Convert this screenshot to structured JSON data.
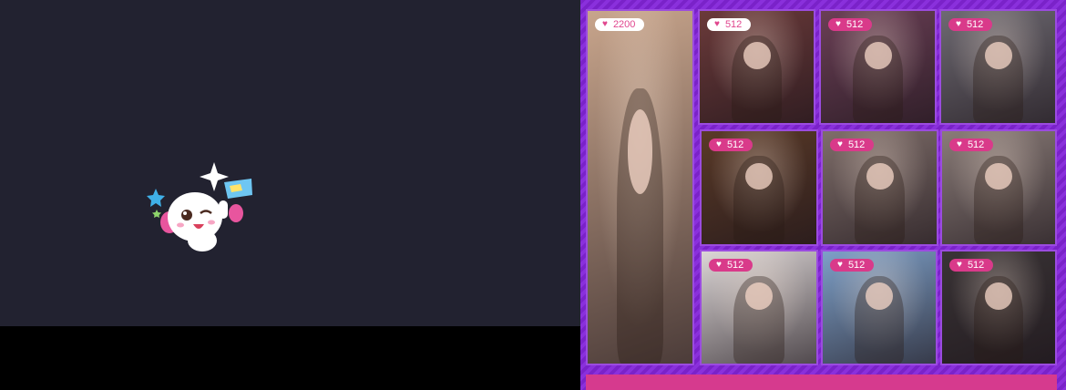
{
  "colors": {
    "left_background": "#222230",
    "right_background": "#7a22c9",
    "badge_pink": "#d93a8a",
    "badge_white": "#ffffff",
    "heart_pink": "#e0468e",
    "bottom_bar": "#d63a8e"
  },
  "mascot": {
    "icon": "winking-dog-mascot-icon"
  },
  "gallery": {
    "tiles": [
      {
        "likes": "2200",
        "badge_style": "white",
        "tone": "#c8a58c"
      },
      {
        "likes": "512",
        "badge_style": "white",
        "tone": "#6b3a3a"
      },
      {
        "likes": "512",
        "badge_style": "pink",
        "tone": "#6a3f55"
      },
      {
        "likes": "512",
        "badge_style": "pink",
        "tone": "#6e6a72"
      },
      {
        "likes": "512",
        "badge_style": "pink",
        "tone": "#5a3a28"
      },
      {
        "likes": "512",
        "badge_style": "pink",
        "tone": "#7f6e6a"
      },
      {
        "likes": "512",
        "badge_style": "pink",
        "tone": "#8a7c78"
      },
      {
        "likes": "512",
        "badge_style": "pink",
        "tone": "#dcd6d6"
      },
      {
        "likes": "512",
        "badge_style": "pink",
        "tone": "#7ea0c8"
      },
      {
        "likes": "512",
        "badge_style": "pink",
        "tone": "#3a3436"
      }
    ]
  }
}
